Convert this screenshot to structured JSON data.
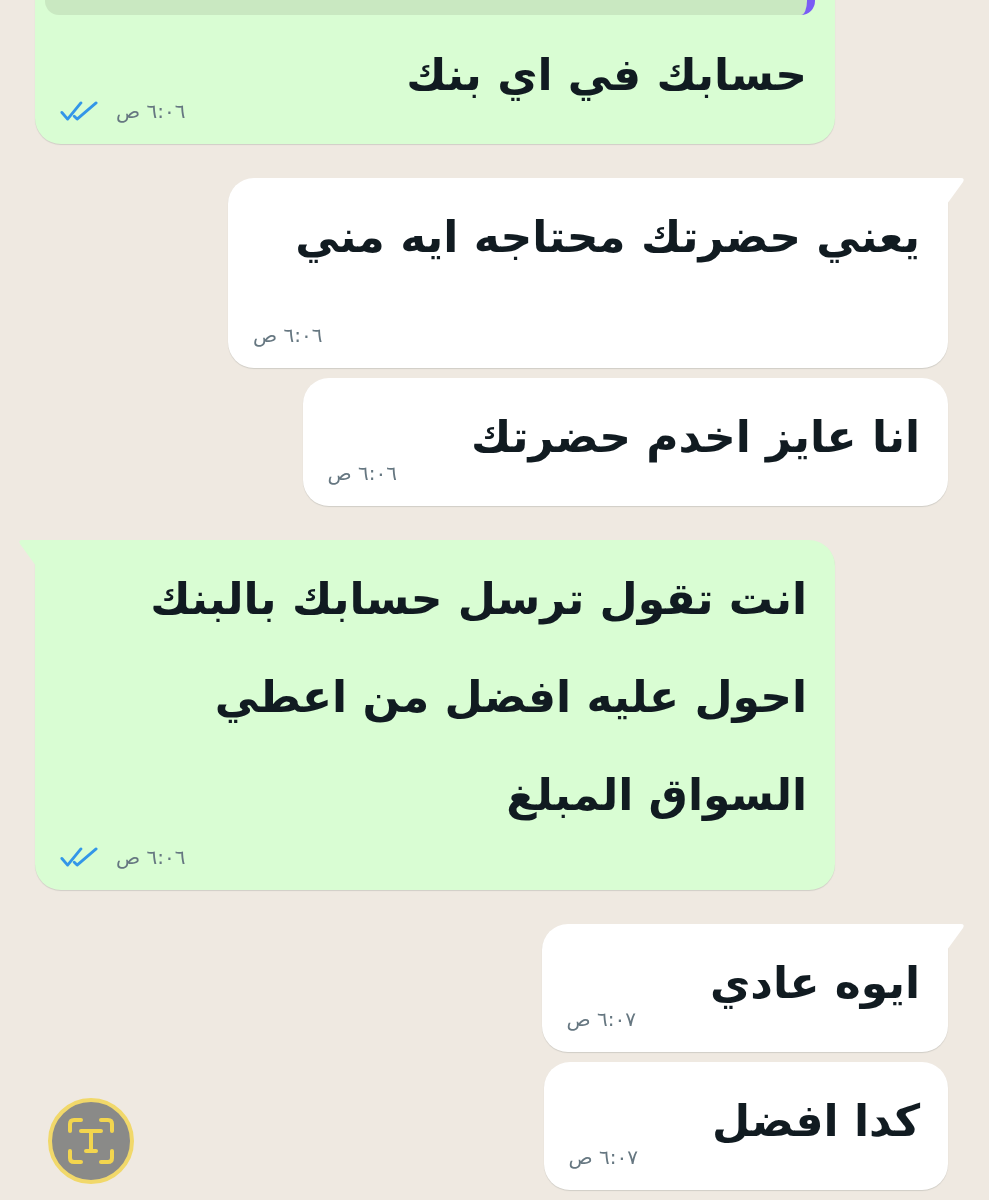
{
  "messages": [
    {
      "kind": "outgoing",
      "tail": false,
      "reply_preview": true,
      "text": "حسابك في اي بنك",
      "time": "٦:٠٦ ص",
      "read": true
    },
    {
      "kind": "incoming",
      "tail": true,
      "reply_preview": false,
      "text": "يعني حضرتك محتاجه ايه مني",
      "time": "٦:٠٦ ص"
    },
    {
      "kind": "incoming",
      "tail": false,
      "reply_preview": false,
      "text": "انا عايز اخدم حضرتك",
      "time": "٦:٠٦ ص"
    },
    {
      "kind": "outgoing",
      "tail": true,
      "reply_preview": false,
      "text": "انت تقول ترسل حسابك بالبنك\nاحول عليه افضل من اعطي\nالسواق المبلغ",
      "time": "٦:٠٦ ص",
      "read": true
    },
    {
      "kind": "incoming",
      "tail": true,
      "reply_preview": false,
      "text": "ايوه عادي",
      "time": "٦:٠٧ ص"
    },
    {
      "kind": "incoming",
      "tail": false,
      "reply_preview": false,
      "text": "كدا افضل",
      "time": "٦:٠٧ ص"
    }
  ]
}
